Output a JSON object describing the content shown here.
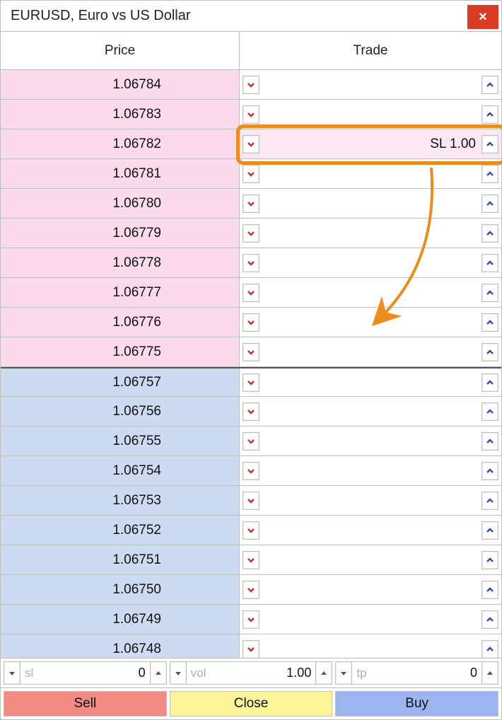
{
  "title": "EURUSD, Euro vs US Dollar",
  "headers": {
    "price": "Price",
    "trade": "Trade"
  },
  "rows": [
    {
      "price": "1.06784",
      "side": "ask",
      "trade": ""
    },
    {
      "price": "1.06783",
      "side": "ask",
      "trade": ""
    },
    {
      "price": "1.06782",
      "side": "ask",
      "trade": "SL 1.00",
      "highlight": true
    },
    {
      "price": "1.06781",
      "side": "ask",
      "trade": ""
    },
    {
      "price": "1.06780",
      "side": "ask",
      "trade": ""
    },
    {
      "price": "1.06779",
      "side": "ask",
      "trade": ""
    },
    {
      "price": "1.06778",
      "side": "ask",
      "trade": ""
    },
    {
      "price": "1.06777",
      "side": "ask",
      "trade": ""
    },
    {
      "price": "1.06776",
      "side": "ask",
      "trade": ""
    },
    {
      "price": "1.06775",
      "side": "ask",
      "trade": ""
    },
    {
      "price": "1.06757",
      "side": "bid",
      "trade": "",
      "divider": true
    },
    {
      "price": "1.06756",
      "side": "bid",
      "trade": ""
    },
    {
      "price": "1.06755",
      "side": "bid",
      "trade": ""
    },
    {
      "price": "1.06754",
      "side": "bid",
      "trade": ""
    },
    {
      "price": "1.06753",
      "side": "bid",
      "trade": ""
    },
    {
      "price": "1.06752",
      "side": "bid",
      "trade": ""
    },
    {
      "price": "1.06751",
      "side": "bid",
      "trade": ""
    },
    {
      "price": "1.06750",
      "side": "bid",
      "trade": ""
    },
    {
      "price": "1.06749",
      "side": "bid",
      "trade": ""
    },
    {
      "price": "1.06748",
      "side": "bid",
      "trade": ""
    }
  ],
  "inputs": {
    "sl": {
      "label": "sl",
      "value": "0"
    },
    "vol": {
      "label": "vol",
      "value": "1.00"
    },
    "tp": {
      "label": "tp",
      "value": "0"
    }
  },
  "buttons": {
    "sell": "Sell",
    "close": "Close",
    "buy": "Buy"
  }
}
